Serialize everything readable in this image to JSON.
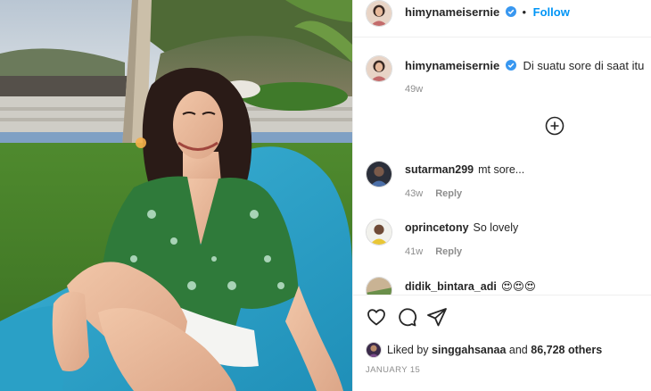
{
  "post": {
    "author": "himynameisernie",
    "follow_label": "Follow",
    "dot": "•",
    "caption": "Di suatu sore di saat itu",
    "caption_age": "49w",
    "date": "JANUARY 15"
  },
  "comments": [
    {
      "user": "sutarman299",
      "text": "mt sore...",
      "age": "43w",
      "reply_label": "Reply"
    },
    {
      "user": "oprincetony",
      "text": "So lovely",
      "age": "41w",
      "reply_label": "Reply"
    },
    {
      "user": "didik_bintara_adi",
      "text": "😍😍😍"
    }
  ],
  "likes": {
    "prefix": "Liked by",
    "user": "singgahsanaa",
    "middle": "and",
    "count": "86,728 others"
  },
  "icons": [
    "verified-badge-icon",
    "plus-circle-icon",
    "heart-icon",
    "comment-icon",
    "share-icon"
  ],
  "colors": {
    "link_blue": "#0095f6",
    "verified_blue": "#3897f0",
    "muted": "#8e8e8e"
  }
}
